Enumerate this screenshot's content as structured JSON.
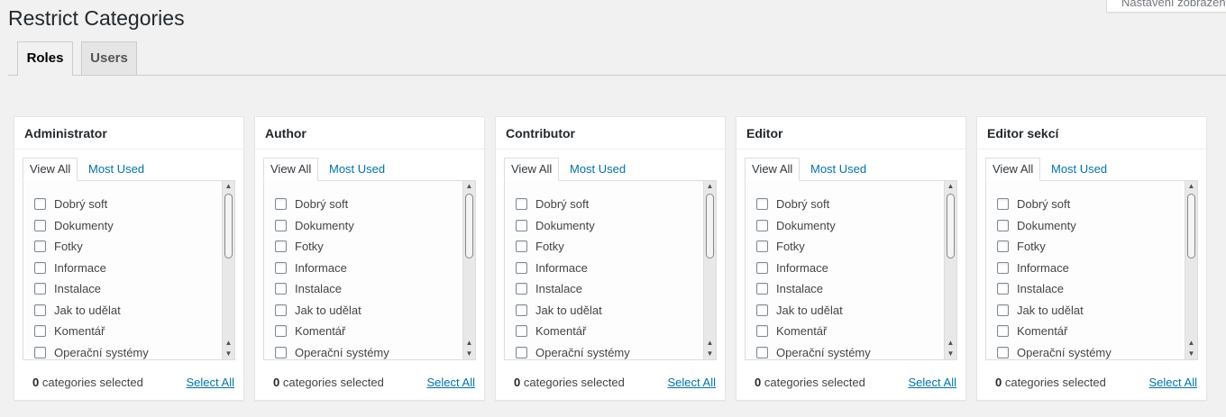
{
  "header": {
    "title": "Restrict Categories",
    "screen_options": "Nastavení zobrazení"
  },
  "nav_tabs": [
    {
      "label": "Roles",
      "active": true
    },
    {
      "label": "Users",
      "active": false
    }
  ],
  "roles": [
    {
      "title": "Administrator",
      "tab_view_all": "View All",
      "tab_most_used": "Most Used",
      "categories": [
        "Dobrý soft",
        "Dokumenty",
        "Fotky",
        "Informace",
        "Instalace",
        "Jak to udělat",
        "Komentář",
        "Operační systémy"
      ],
      "selected_count": "0",
      "selected_text": "categories selected",
      "select_all": "Select All"
    },
    {
      "title": "Author",
      "tab_view_all": "View All",
      "tab_most_used": "Most Used",
      "categories": [
        "Dobrý soft",
        "Dokumenty",
        "Fotky",
        "Informace",
        "Instalace",
        "Jak to udělat",
        "Komentář",
        "Operační systémy"
      ],
      "selected_count": "0",
      "selected_text": "categories selected",
      "select_all": "Select All"
    },
    {
      "title": "Contributor",
      "tab_view_all": "View All",
      "tab_most_used": "Most Used",
      "categories": [
        "Dobrý soft",
        "Dokumenty",
        "Fotky",
        "Informace",
        "Instalace",
        "Jak to udělat",
        "Komentář",
        "Operační systémy"
      ],
      "selected_count": "0",
      "selected_text": "categories selected",
      "select_all": "Select All"
    },
    {
      "title": "Editor",
      "tab_view_all": "View All",
      "tab_most_used": "Most Used",
      "categories": [
        "Dobrý soft",
        "Dokumenty",
        "Fotky",
        "Informace",
        "Instalace",
        "Jak to udělat",
        "Komentář",
        "Operační systémy"
      ],
      "selected_count": "0",
      "selected_text": "categories selected",
      "select_all": "Select All"
    },
    {
      "title": "Editor sekcí",
      "tab_view_all": "View All",
      "tab_most_used": "Most Used",
      "categories": [
        "Dobrý soft",
        "Dokumenty",
        "Fotky",
        "Informace",
        "Instalace",
        "Jak to udělat",
        "Komentář",
        "Operační systémy"
      ],
      "selected_count": "0",
      "selected_text": "categories selected",
      "select_all": "Select All"
    }
  ],
  "icons": {
    "scroll_up": "scroll-up-arrow-icon",
    "scroll_down": "scroll-down-arrow-icon"
  },
  "colors": {
    "link": "#0073aa",
    "background": "#f1f1f1"
  }
}
